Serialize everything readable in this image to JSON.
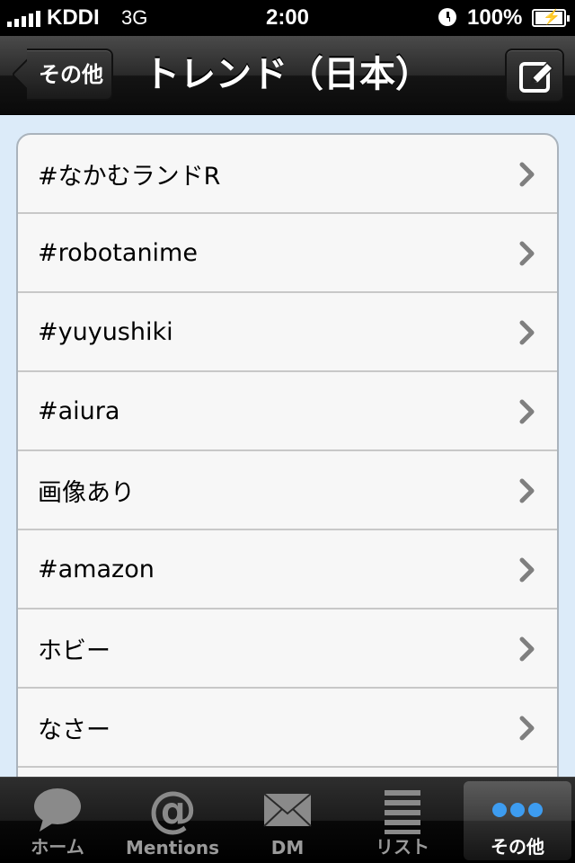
{
  "status_bar": {
    "carrier": "KDDI",
    "network": "3G",
    "time": "2:00",
    "battery": "100%"
  },
  "nav": {
    "back_label": "その他",
    "title": "トレンド（日本）",
    "compose_icon": "compose-icon"
  },
  "trends": [
    {
      "label": "#なかむランドR"
    },
    {
      "label": "#robotanime"
    },
    {
      "label": "#yuyushiki"
    },
    {
      "label": "#aiura"
    },
    {
      "label": "画像あり"
    },
    {
      "label": "#amazon"
    },
    {
      "label": "ホビー"
    },
    {
      "label": "なさー"
    },
    {
      "label": ""
    }
  ],
  "tabs": [
    {
      "label": "ホーム",
      "icon": "speech-bubble-icon"
    },
    {
      "label": "Mentions",
      "icon": "at-sign-icon"
    },
    {
      "label": "DM",
      "icon": "envelope-icon"
    },
    {
      "label": "リスト",
      "icon": "list-icon"
    },
    {
      "label": "その他",
      "icon": "more-dots-icon",
      "selected": true
    }
  ],
  "colors": {
    "content_bg": "#dcebf9",
    "row_bg": "#f7f7f7",
    "tab_selected_dots": "#3d9cf0"
  }
}
